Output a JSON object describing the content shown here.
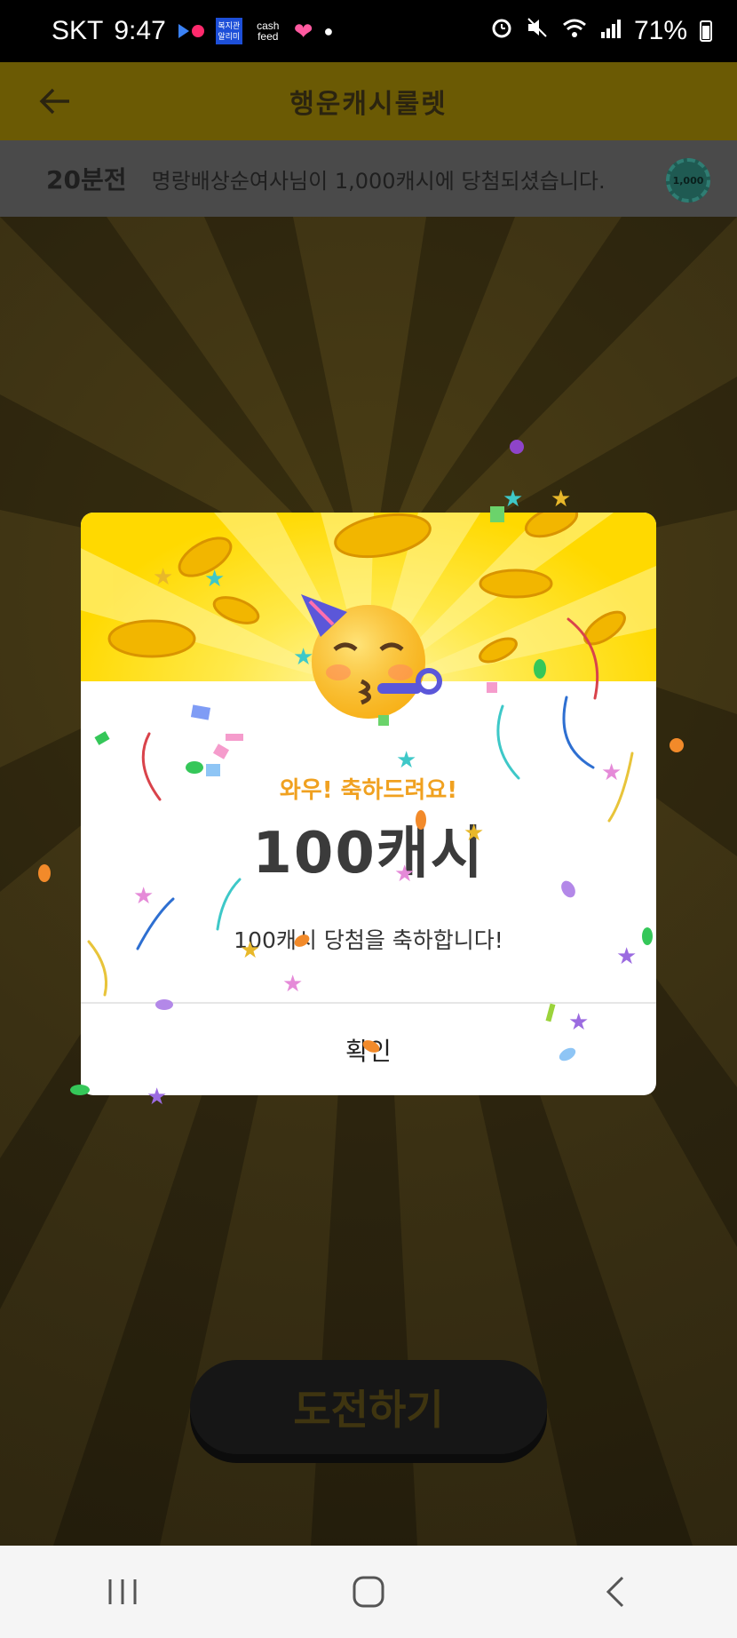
{
  "status_bar": {
    "carrier": "SKT",
    "time": "9:47",
    "app_badge": "복지관 알리미",
    "cashfeed": "cash feed",
    "battery": "71%"
  },
  "app_bar": {
    "title": "행운캐시룰렛"
  },
  "ticker": {
    "time_ago": "20분전",
    "message": "명랑배상순여사님이 1,000캐시에 당첨되셨습니다.",
    "coin_label": "1,000"
  },
  "modal": {
    "headline": "와우! 축하드려요!",
    "amount": "100캐시",
    "message": "100캐시 당첨을 축하합니다!",
    "confirm_label": "확인"
  },
  "challenge_button": {
    "label": "도전하기"
  },
  "colors": {
    "accent_yellow": "#ffd900",
    "headline_orange": "#f0a120"
  }
}
